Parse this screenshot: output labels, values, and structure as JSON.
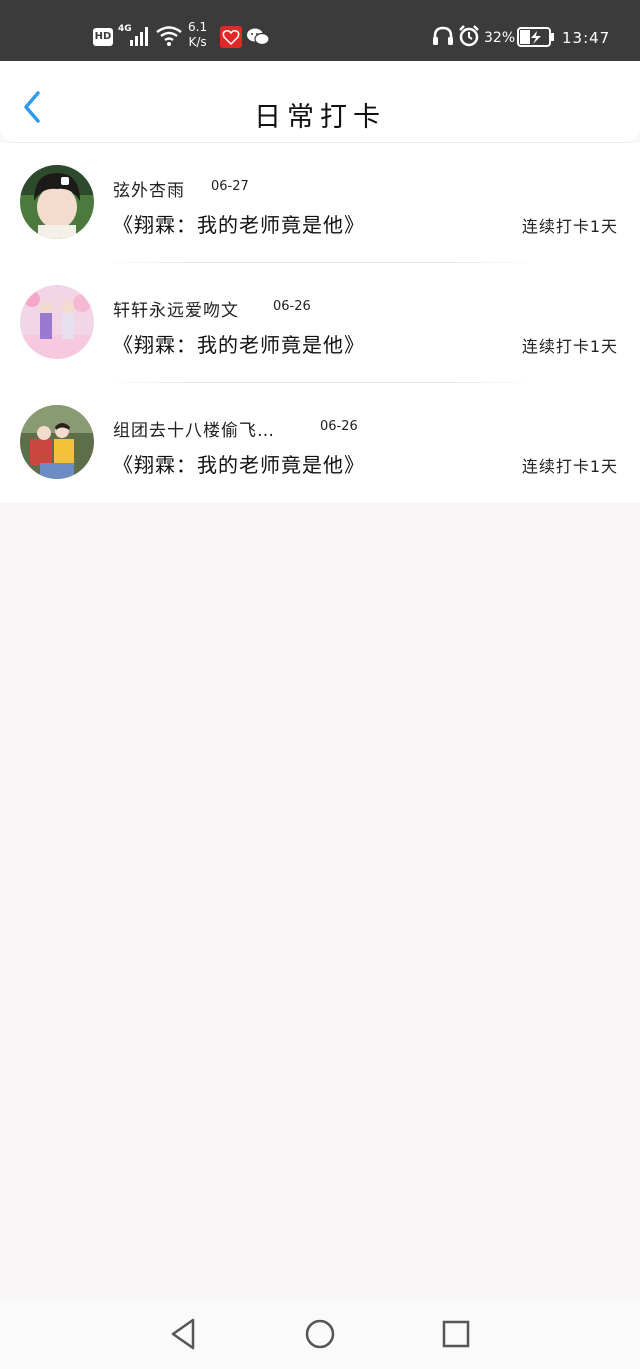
{
  "status_bar": {
    "hd": "HD",
    "network": "4G",
    "speed_value": "6.1",
    "speed_unit": "K/s",
    "battery_percent": "32%",
    "time": "13:47"
  },
  "header": {
    "title": "日常打卡"
  },
  "list": [
    {
      "username": "弦外杏雨",
      "date": "06-27",
      "book_title": "《翔霖：我的老师竟是他》",
      "streak": "连续打卡1天"
    },
    {
      "username": "轩轩永远爱吻文",
      "date": "06-26",
      "book_title": "《翔霖：我的老师竟是他》",
      "streak": "连续打卡1天"
    },
    {
      "username": "组团去十八楼偷飞…",
      "date": "06-26",
      "book_title": "《翔霖：我的老师竟是他》",
      "streak": "连续打卡1天"
    }
  ],
  "colors": {
    "accent": "#2f9be8",
    "status_bar_bg": "#3b3b3b",
    "page_bg": "#f8f6f7"
  }
}
